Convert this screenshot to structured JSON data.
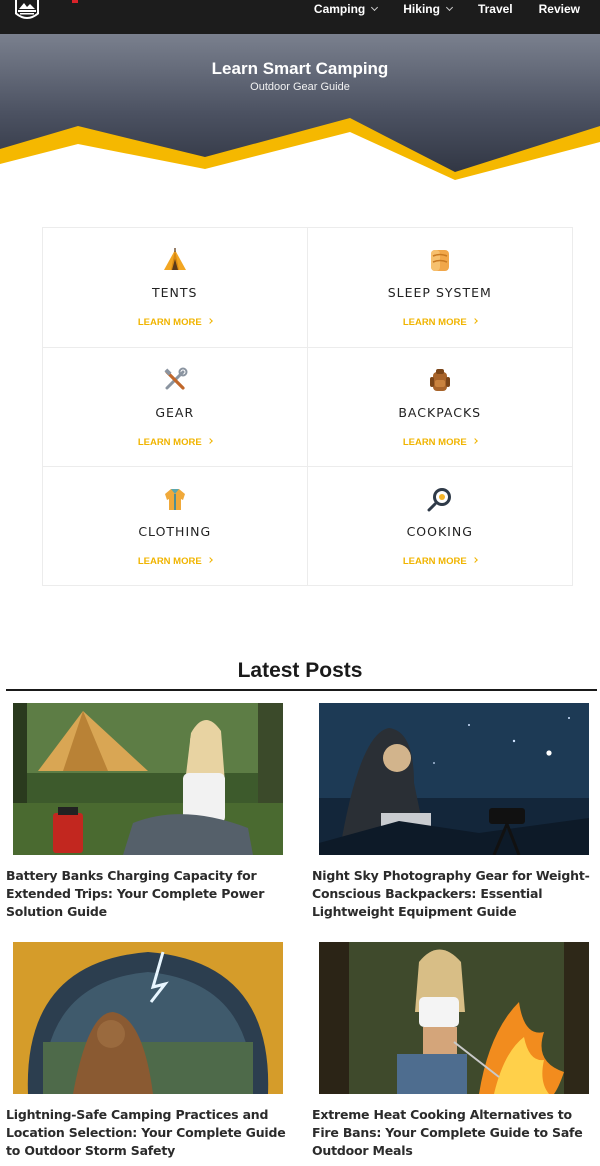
{
  "nav": {
    "items": [
      {
        "label": "Camping",
        "has_dropdown": true
      },
      {
        "label": "Hiking",
        "has_dropdown": true
      },
      {
        "label": "Travel",
        "has_dropdown": false
      },
      {
        "label": "Review",
        "has_dropdown": false
      }
    ]
  },
  "hero": {
    "title": "Learn Smart Camping",
    "subtitle": "Outdoor Gear Guide"
  },
  "categories": [
    {
      "title": "TENTS",
      "link": "LEARN MORE",
      "icon": "tent-icon"
    },
    {
      "title": "SLEEP SYSTEM",
      "link": "LEARN MORE",
      "icon": "sleeping-bag-icon"
    },
    {
      "title": "GEAR",
      "link": "LEARN MORE",
      "icon": "tools-icon"
    },
    {
      "title": "BACKPACKS",
      "link": "LEARN MORE",
      "icon": "backpack-icon"
    },
    {
      "title": "CLOTHING",
      "link": "LEARN MORE",
      "icon": "jacket-icon"
    },
    {
      "title": "COOKING",
      "link": "LEARN MORE",
      "icon": "frying-pan-icon"
    }
  ],
  "latest": {
    "heading": "Latest Posts",
    "posts": [
      {
        "title": "Battery Banks Charging Capacity for Extended Trips: Your Complete Power Solution Guide"
      },
      {
        "title": "Night Sky Photography Gear for Weight-Conscious Backpackers: Essential Lightweight Equipment Guide"
      },
      {
        "title": "Lightning-Safe Camping Practices and Location Selection: Your Complete Guide to Outdoor Storm Safety"
      },
      {
        "title": "Extreme Heat Cooking Alternatives to Fire Bans: Your Complete Guide to Safe Outdoor Meals"
      }
    ]
  },
  "colors": {
    "topbar": "#1c1c1c",
    "accent": "#f0b400",
    "hero_wave": "#f5b800"
  }
}
